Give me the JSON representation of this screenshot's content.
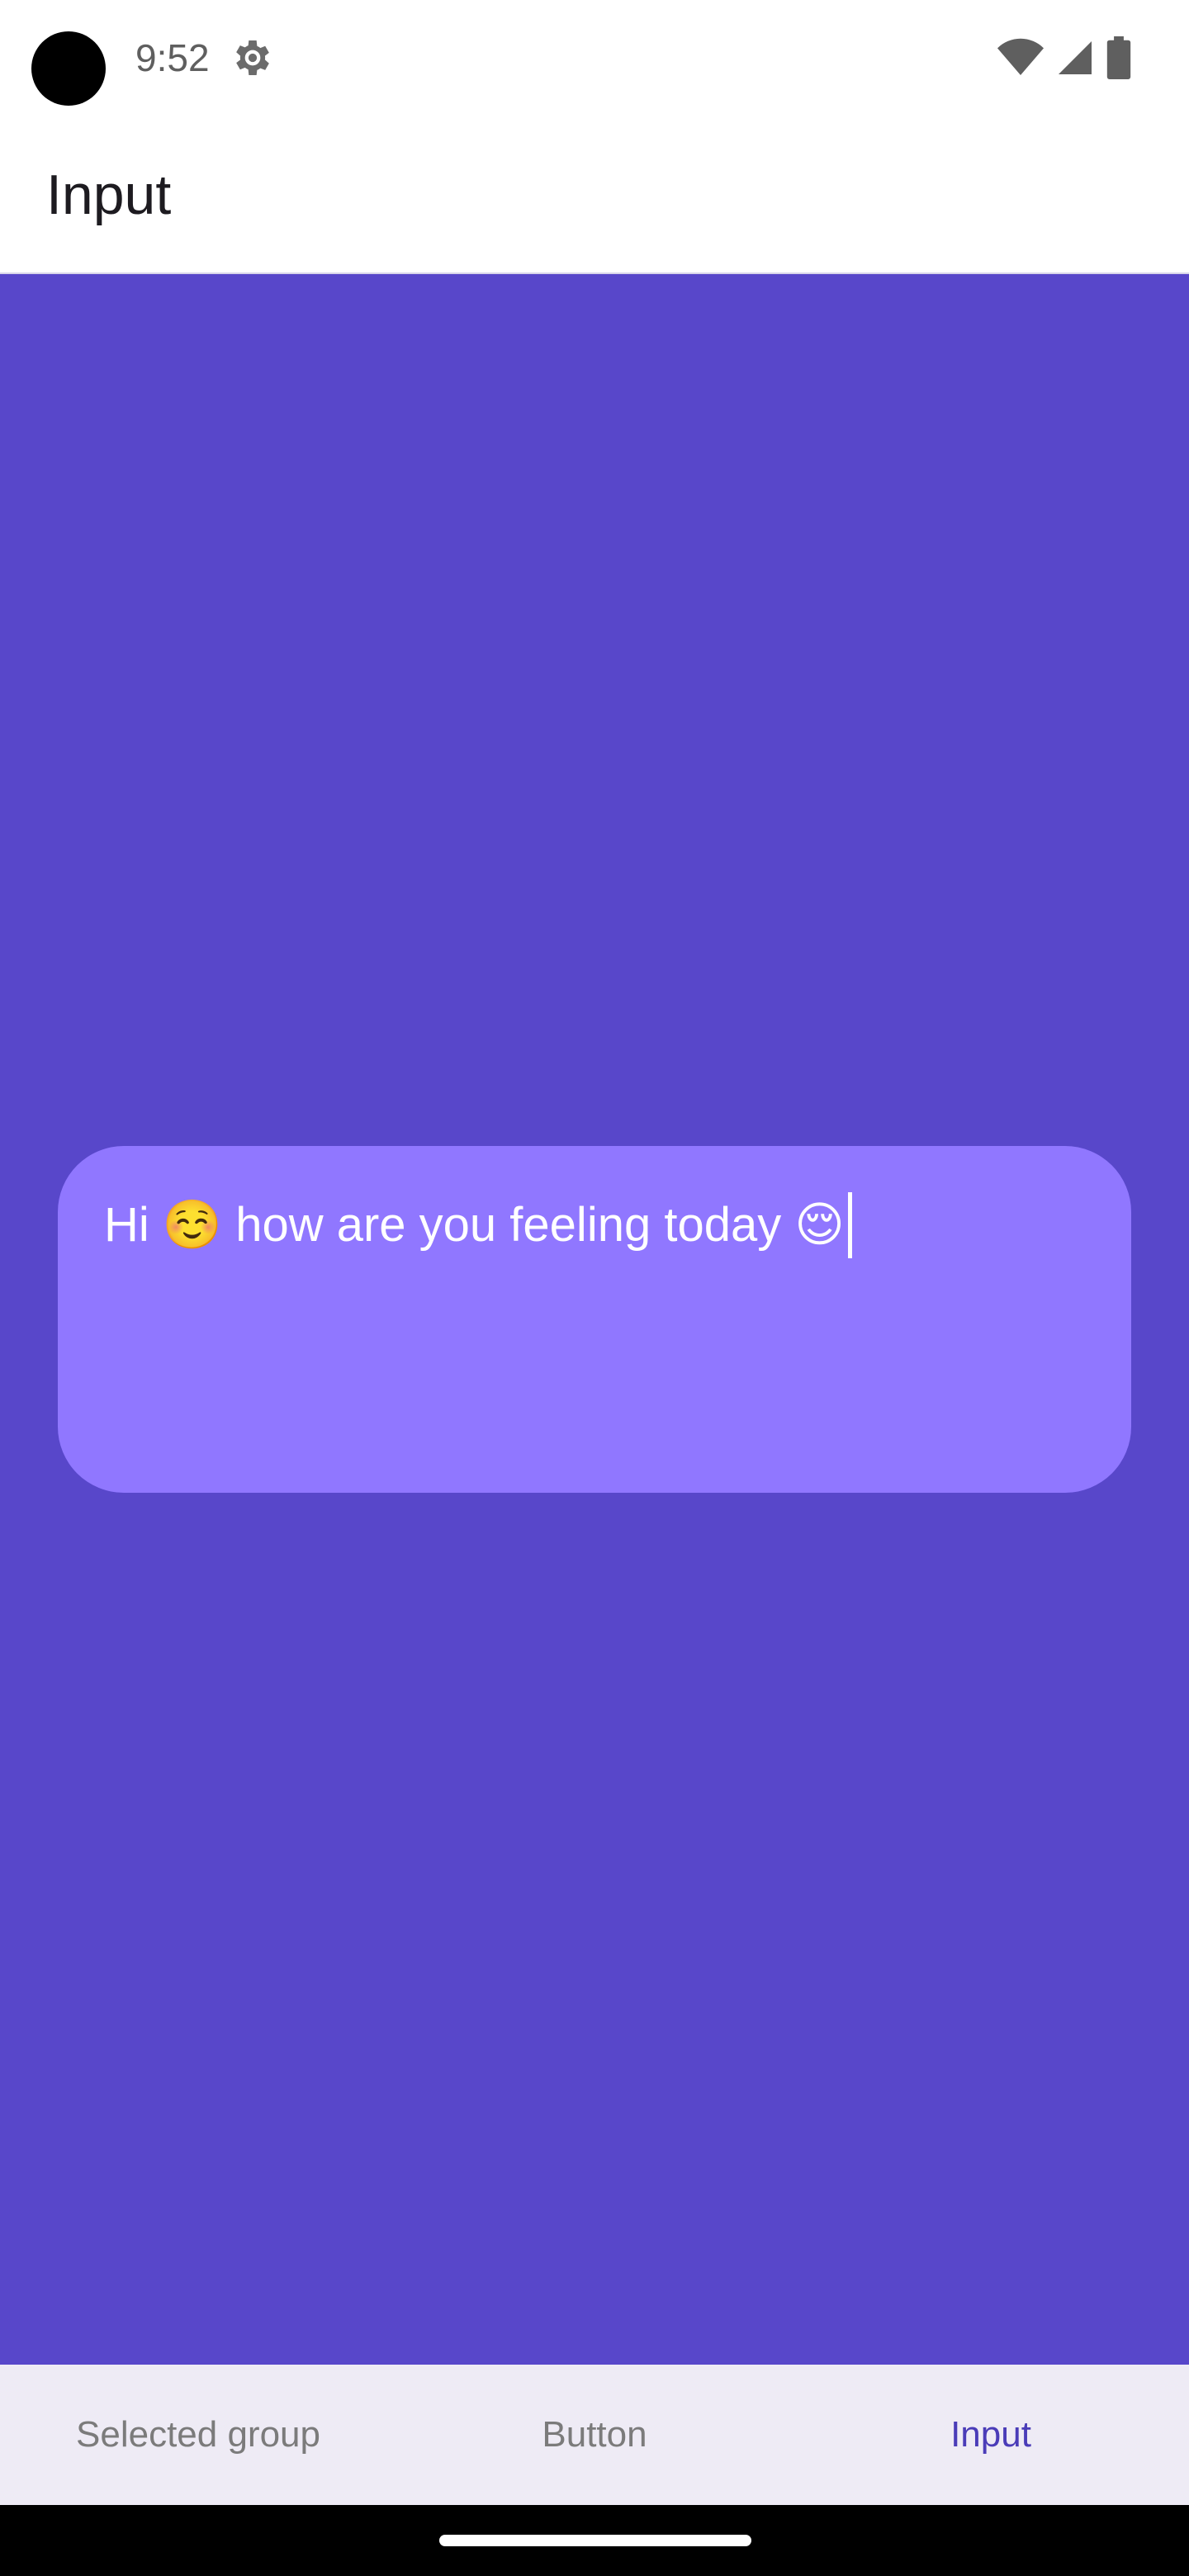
{
  "status_bar": {
    "time": "9:52",
    "icons": [
      "settings-icon",
      "wifi-icon",
      "cellular-signal-icon",
      "battery-icon"
    ]
  },
  "app_bar": {
    "title": "Input"
  },
  "input": {
    "value": "Hi ☺️ how are you feeling today 😌"
  },
  "bottom_nav": {
    "items": [
      {
        "label": "Selected group",
        "active": false
      },
      {
        "label": "Button",
        "active": false
      },
      {
        "label": "Input",
        "active": true
      }
    ]
  },
  "colors": {
    "background": "#5847ca",
    "input_fill": "#9077ff",
    "nav_active": "#4a3cb8",
    "nav_inactive": "#7b7b7b"
  }
}
